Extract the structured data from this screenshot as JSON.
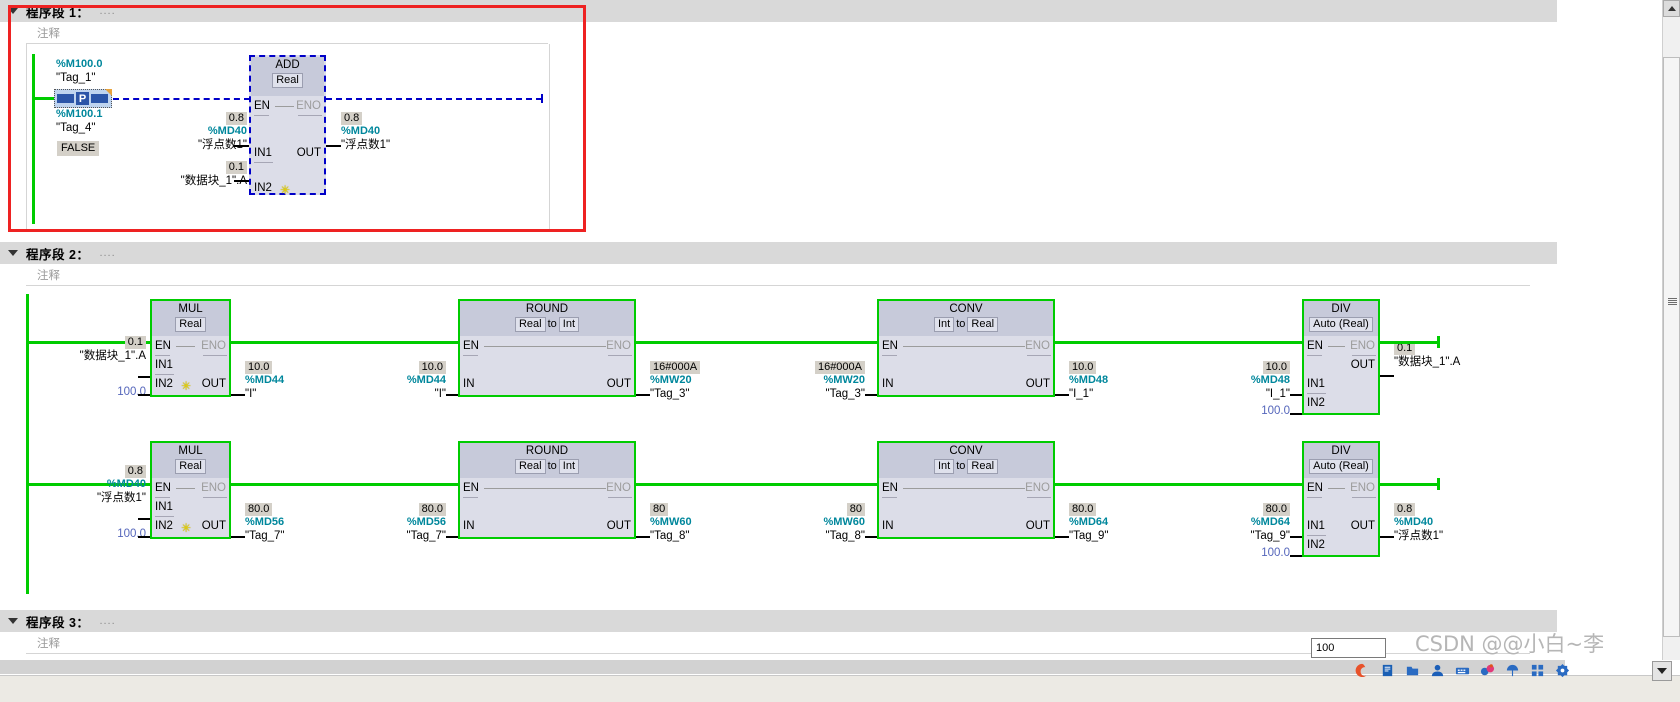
{
  "app": {
    "zoom_value": "100",
    "watermark": "CSDN @@小白~李"
  },
  "networks": [
    {
      "title": "程序段 1：",
      "dots": "....",
      "comment": "注释"
    },
    {
      "title": "程序段 2：",
      "dots": "....",
      "comment": "注释"
    },
    {
      "title": "程序段 3：",
      "dots": "....",
      "comment": "注释"
    }
  ],
  "network1": {
    "contact": {
      "addr_top": "%M100.0",
      "tag_top": "\"Tag_1\"",
      "symbol": "P",
      "addr_bottom": "%M100.1",
      "tag_bottom": "\"Tag_4\"",
      "status": "FALSE"
    },
    "add_block": {
      "name": "ADD",
      "type": "Real",
      "en": "EN",
      "eno": "ENO",
      "in1": "IN1",
      "in2": "IN2",
      "out": "OUT",
      "in1_value": "0.8",
      "in1_addr": "%MD40",
      "in1_tag": "\"浮点数1\"",
      "in2_value": "0.1",
      "in2_tag": "\"数据块_1\".A",
      "out_value": "0.8",
      "out_addr": "%MD40",
      "out_tag": "\"浮点数1\""
    }
  },
  "network2": {
    "row1": {
      "mul": {
        "name": "MUL",
        "type": "Real",
        "en": "EN",
        "eno": "ENO",
        "in1": "IN1",
        "in2": "IN2",
        "out": "OUT",
        "in1_value": "0.1",
        "in1_tag": "\"数据块_1\".A",
        "in2_const": "100.0",
        "out_value": "10.0",
        "out_addr": "%MD44",
        "out_tag": "\"I\""
      },
      "round": {
        "name": "ROUND",
        "type_from": "Real",
        "type_mid": "to",
        "type_to": "Int",
        "en": "EN",
        "eno": "ENO",
        "in": "IN",
        "out": "OUT",
        "in_value": "10.0",
        "in_addr": "%MD44",
        "in_tag": "\"I\"",
        "out_value": "16#000A",
        "out_addr": "%MW20",
        "out_tag": "\"Tag_3\""
      },
      "conv": {
        "name": "CONV",
        "type_from": "Int",
        "type_mid": "to",
        "type_to": "Real",
        "en": "EN",
        "eno": "ENO",
        "in": "IN",
        "out": "OUT",
        "in_value": "16#000A",
        "in_addr": "%MW20",
        "in_tag": "\"Tag_3\"",
        "out_value": "10.0",
        "out_addr": "%MD48",
        "out_tag": "\"I_1\""
      },
      "div": {
        "name": "DIV",
        "type": "Auto (Real)",
        "en": "EN",
        "eno": "ENO",
        "in1": "IN1",
        "in2": "IN2",
        "out": "OUT",
        "in1_value": "10.0",
        "in1_addr": "%MD48",
        "in1_tag": "\"I_1\"",
        "in2_const": "100.0",
        "out_value": "0.1",
        "out_tag": "\"数据块_1\".A"
      }
    },
    "row2": {
      "mul": {
        "name": "MUL",
        "type": "Real",
        "en": "EN",
        "eno": "ENO",
        "in1": "IN1",
        "in2": "IN2",
        "out": "OUT",
        "in1_value": "0.8",
        "in1_addr": "%MD40",
        "in1_tag": "\"浮点数1\"",
        "in2_const": "100.0",
        "out_value": "80.0",
        "out_addr": "%MD56",
        "out_tag": "\"Tag_7\""
      },
      "round": {
        "name": "ROUND",
        "type_from": "Real",
        "type_mid": "to",
        "type_to": "Int",
        "en": "EN",
        "eno": "ENO",
        "in": "IN",
        "out": "OUT",
        "in_value": "80.0",
        "in_addr": "%MD56",
        "in_tag": "\"Tag_7\"",
        "out_value": "80",
        "out_addr": "%MW60",
        "out_tag": "\"Tag_8\""
      },
      "conv": {
        "name": "CONV",
        "type_from": "Int",
        "type_mid": "to",
        "type_to": "Real",
        "en": "EN",
        "eno": "ENO",
        "in": "IN",
        "out": "OUT",
        "in_value": "80",
        "in_addr": "%MW60",
        "in_tag": "\"Tag_8\"",
        "out_value": "80.0",
        "out_addr": "%MD64",
        "out_tag": "\"Tag_9\""
      },
      "div": {
        "name": "DIV",
        "type": "Auto (Real)",
        "en": "EN",
        "eno": "ENO",
        "in1": "IN1",
        "in2": "IN2",
        "out": "OUT",
        "in1_value": "80.0",
        "in1_addr": "%MD64",
        "in1_tag": "\"Tag_9\"",
        "in2_const": "100.0",
        "out_value": "0.8",
        "out_addr": "%MD40",
        "out_tag": "\"浮点数1\""
      }
    }
  }
}
